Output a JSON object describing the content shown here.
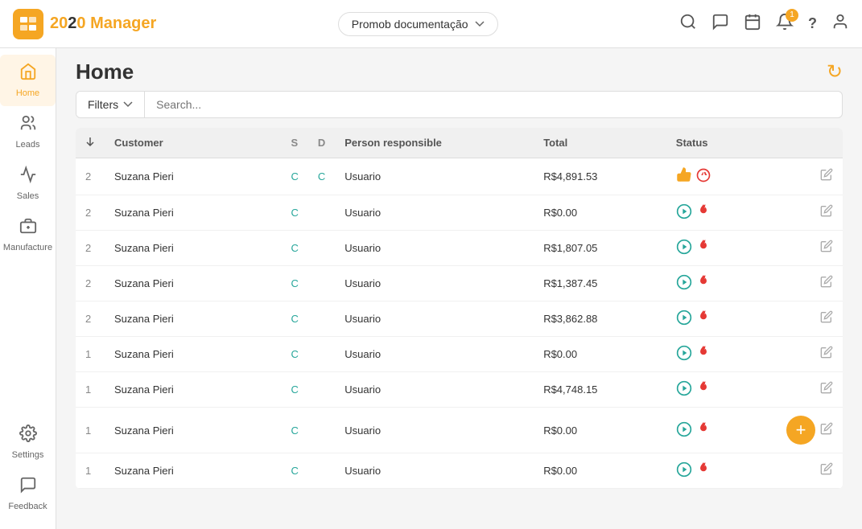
{
  "header": {
    "logo_text": "2020",
    "logo_sub": "Manager",
    "dropdown_label": "Promob documentação",
    "dropdown_icon": "▼"
  },
  "sidebar": {
    "items": [
      {
        "id": "home",
        "label": "Home",
        "active": true
      },
      {
        "id": "leads",
        "label": "Leads",
        "active": false
      },
      {
        "id": "sales",
        "label": "Sales",
        "active": false
      },
      {
        "id": "manufacture",
        "label": "Manufacture",
        "active": false
      },
      {
        "id": "settings",
        "label": "Settings",
        "active": false
      }
    ],
    "feedback_label": "Feedback"
  },
  "main": {
    "page_title": "Home",
    "filter_label": "Filters",
    "search_placeholder": "Search...",
    "table": {
      "columns": [
        "",
        "Customer",
        "S",
        "D",
        "Person responsible",
        "Total",
        "Status",
        ""
      ],
      "rows": [
        {
          "num": "2",
          "customer": "Suzana Pieri",
          "s": "C",
          "d": "C",
          "person": "Usuario",
          "total": "R$4,891.53",
          "status": "thumb_fire",
          "edit": true,
          "add": false
        },
        {
          "num": "2",
          "customer": "Suzana Pieri",
          "s": "C",
          "d": "",
          "person": "Usuario",
          "total": "R$0.00",
          "status": "play_fire",
          "edit": true,
          "add": false
        },
        {
          "num": "2",
          "customer": "Suzana Pieri",
          "s": "C",
          "d": "",
          "person": "Usuario",
          "total": "R$1,807.05",
          "status": "play_fire",
          "edit": true,
          "add": false
        },
        {
          "num": "2",
          "customer": "Suzana Pieri",
          "s": "C",
          "d": "",
          "person": "Usuario",
          "total": "R$1,387.45",
          "status": "play_fire",
          "edit": true,
          "add": false
        },
        {
          "num": "2",
          "customer": "Suzana Pieri",
          "s": "C",
          "d": "",
          "person": "Usuario",
          "total": "R$3,862.88",
          "status": "play_fire",
          "edit": true,
          "add": false
        },
        {
          "num": "1",
          "customer": "Suzana Pieri",
          "s": "C",
          "d": "",
          "person": "Usuario",
          "total": "R$0.00",
          "status": "play_fire",
          "edit": true,
          "add": false
        },
        {
          "num": "1",
          "customer": "Suzana Pieri",
          "s": "C",
          "d": "",
          "person": "Usuario",
          "total": "R$4,748.15",
          "status": "play_fire",
          "edit": true,
          "add": false
        },
        {
          "num": "1",
          "customer": "Suzana Pieri",
          "s": "C",
          "d": "",
          "person": "Usuario",
          "total": "R$0.00",
          "status": "play_fire",
          "edit": true,
          "add": true
        },
        {
          "num": "1",
          "customer": "Suzana Pieri",
          "s": "C",
          "d": "",
          "person": "Usuario",
          "total": "R$0.00",
          "status": "play_fire",
          "edit": true,
          "add": false
        }
      ]
    }
  },
  "icons": {
    "search": "🔍",
    "chat": "💬",
    "calendar": "📅",
    "bell": "🔔",
    "help": "?",
    "user": "👤",
    "refresh": "↻",
    "edit": "✏",
    "add": "+",
    "sort_down": "↓",
    "filter_chevron": "▾"
  },
  "colors": {
    "orange": "#f5a623",
    "teal": "#26a69a",
    "red": "#e53935",
    "gray": "#888"
  }
}
